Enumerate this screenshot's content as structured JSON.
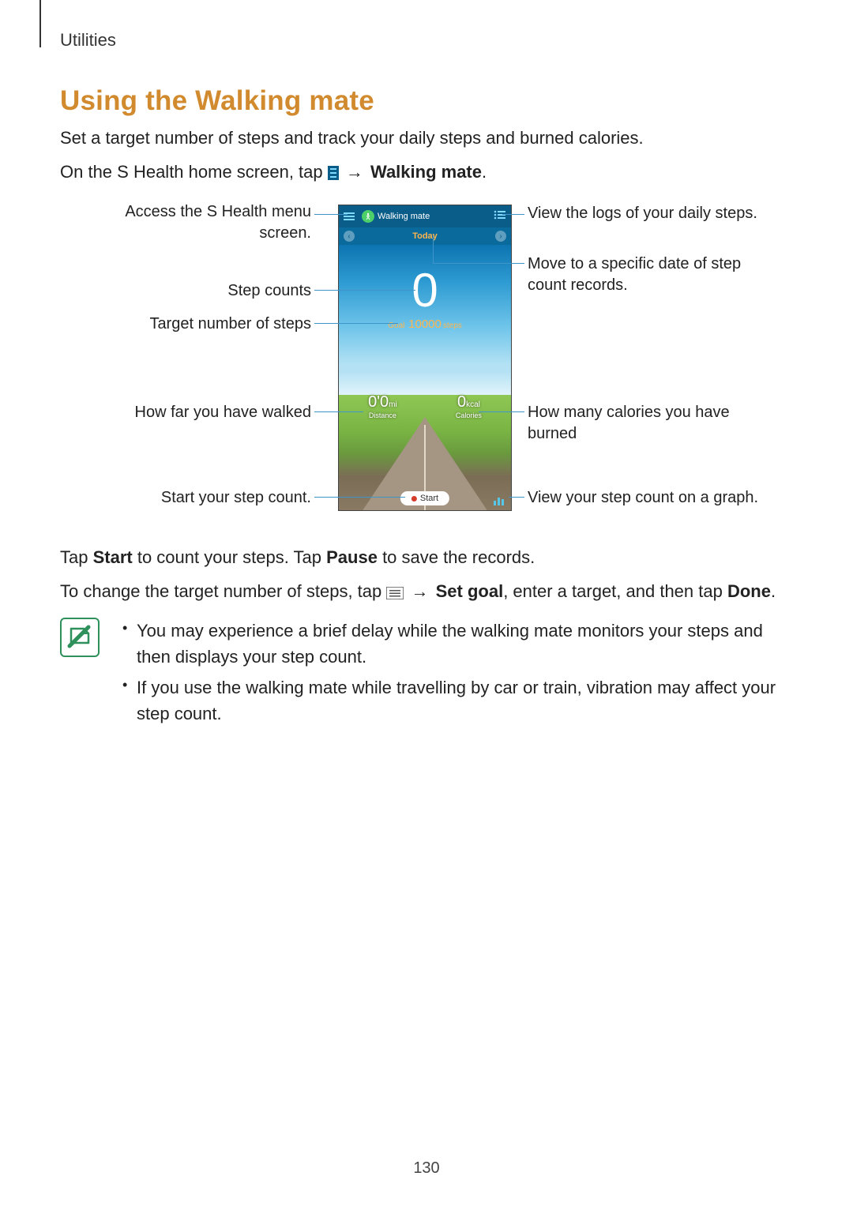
{
  "header": {
    "section": "Utilities"
  },
  "title": "Using the Walking mate",
  "intro": "Set a target number of steps and track your daily steps and burned calories.",
  "instruction": {
    "pre": "On the S Health home screen, tap ",
    "arrow": "→",
    "target": "Walking mate",
    "post": "."
  },
  "callouts": {
    "menu": "Access the S Health menu screen.",
    "logs": "View the logs of your daily steps.",
    "step_counts": "Step counts",
    "move_date": "Move to a specific date of step count records.",
    "target_steps": "Target number of steps",
    "distance": "How far you have walked",
    "calories": "How many calories you have burned",
    "start": "Start your step count.",
    "graph": "View your step count on a graph."
  },
  "phone": {
    "app_title": "Walking mate",
    "date_label": "Today",
    "big_count": "0",
    "goal_prefix": "Goal",
    "goal_value": "10000",
    "goal_suffix": "steps",
    "distance_val1": "0'",
    "distance_val2": "0",
    "distance_unit": "mi",
    "distance_lbl": "Distance",
    "calories_val": "0",
    "calories_unit": "kcal",
    "calories_lbl": "Calories",
    "start_label": "Start"
  },
  "after1": {
    "pre": "Tap ",
    "b1": "Start",
    "mid": " to count your steps. Tap ",
    "b2": "Pause",
    "post": " to save the records."
  },
  "after2": {
    "pre": "To change the target number of steps, tap ",
    "arrow": "→",
    "b1": "Set goal",
    "mid": ", enter a target, and then tap ",
    "b2": "Done",
    "post": "."
  },
  "notes": [
    "You may experience a brief delay while the walking mate monitors your steps and then displays your step count.",
    "If you use the walking mate while travelling by car or train, vibration may affect your step count."
  ],
  "page_number": "130"
}
